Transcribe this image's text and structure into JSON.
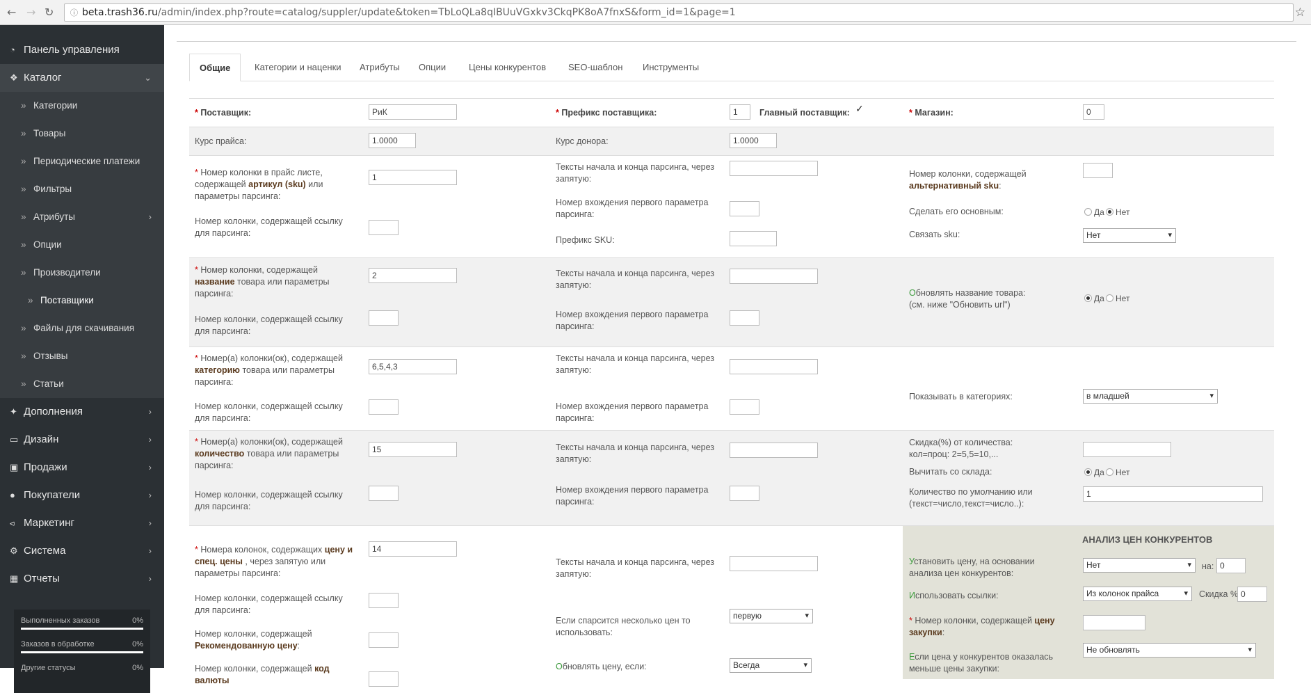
{
  "browser": {
    "url_host": "beta.trash36.ru",
    "url_path": "/admin/index.php?route=catalog/suppler/update&token=TbLoQLa8qIBUuVGxkv3CkqPK8oA7fnxS&form_id=1&page=1"
  },
  "sidebar": {
    "items": [
      {
        "label": "Панель управления",
        "icon": "dashboard-icon"
      },
      {
        "label": "Каталог",
        "icon": "tag-icon"
      },
      {
        "label": "Дополнения",
        "icon": "puzzle-icon"
      },
      {
        "label": "Дизайн",
        "icon": "monitor-icon"
      },
      {
        "label": "Продажи",
        "icon": "cart-icon"
      },
      {
        "label": "Покупатели",
        "icon": "user-icon"
      },
      {
        "label": "Маркетинг",
        "icon": "share-icon"
      },
      {
        "label": "Система",
        "icon": "gear-icon"
      },
      {
        "label": "Отчеты",
        "icon": "bar-chart-icon"
      }
    ],
    "catalog_sub": [
      "Категории",
      "Товары",
      "Периодические платежи",
      "Фильтры",
      "Атрибуты",
      "Опции",
      "Производители",
      "Поставщики",
      "Файлы для скачивания",
      "Отзывы",
      "Статьи"
    ],
    "stats": [
      {
        "label": "Выполненных заказов",
        "value": "0%"
      },
      {
        "label": "Заказов в обработке",
        "value": "0%"
      },
      {
        "label": "Другие статусы",
        "value": "0%"
      }
    ]
  },
  "tabs": [
    "Общие",
    "Категории и наценки",
    "Атрибуты",
    "Опции",
    "Цены конкурентов",
    "SEO-шаблон",
    "Инструменты"
  ],
  "form": {
    "r1": {
      "supplier_label": "Поставщик:",
      "supplier_value": "РиК",
      "prefix_label": "Префикс поставщика:",
      "prefix_value": "1",
      "main_label": "Главный поставщик:",
      "shop_label": "Магазин:",
      "shop_value": "0"
    },
    "r2": {
      "price_rate_label": "Курс прайса:",
      "price_rate_value": "1.0000",
      "donor_rate_label": "Курс донора:",
      "donor_rate_value": "1.0000"
    },
    "r3": {
      "sku_label_a": "Номер колонки в прайс листе, содержащей ",
      "sku_label_b": "артикул (sku)",
      "sku_label_c": " или параметры парсинга:",
      "sku_value": "1",
      "link_label": "Номер колонки, содержащей ссылку для парсинга:",
      "texts_label": "Тексты начала и конца парсинга, через запятую:",
      "occ_label": "Номер вхождения первого параметра парсинга:",
      "prefix_sku_label": "Префикс SKU:",
      "alt_sku_label_a": "Номер колонки, содержащей ",
      "alt_sku_label_b": "альтернативный sku",
      "alt_sku_label_c": ":",
      "make_main_label": "Сделать его основным:",
      "yes": "Да",
      "no": "Нет",
      "link_sku_label": "Связать sku:",
      "link_sku_value": "Нет"
    },
    "r4": {
      "name_label_a": "Номер колонки, содержащей ",
      "name_label_b": "название",
      "name_label_c": " товара или параметры парсинга:",
      "name_value": "2",
      "update_name_label_a": "О",
      "update_name_label_b": "бновлять название товара:",
      "update_name_label_c": "(см. ниже \"Обновить url\")"
    },
    "r5": {
      "cat_label_a": "Номер(а) колонки(ок), содержащей ",
      "cat_label_b": "категорию",
      "cat_label_c": " товара или параметры парсинга:",
      "cat_value": "6,5,4,3",
      "show_in_label": "Показывать в категориях:",
      "show_in_value": "в младшей"
    },
    "r6": {
      "qty_label_a": "Номер(а) колонки(ок), содержащей ",
      "qty_label_b": "количество",
      "qty_label_c": " товара или параметры парсинга:",
      "qty_value": "15",
      "discount_label": "Скидка(%) от количества: кол=проц: 2=5,5=10,...",
      "subtract_label": "Вычитать со склада:",
      "default_qty_label": "Количество по умолчанию или (текст=число,текст=число..):",
      "default_qty_value": "1"
    },
    "r7": {
      "price_label_a": "Номера колонок, содержащих ",
      "price_label_b": "цену и спец. цены",
      "price_label_c": " , через запятую или параметры парсинга:",
      "price_value": "14",
      "rec_label_a": "Номер колонки, содержащей ",
      "rec_label_b": "Рекомендованную цену",
      "rec_label_c": ":",
      "cur_label_a": "Номер колонки, содержащей ",
      "cur_label_b": "код валюты",
      "multi_label": "Если спарсится несколько цен то использовать:",
      "multi_value": "первую",
      "upd_price_label_a": "О",
      "upd_price_label_b": "бновлять цену, если:",
      "upd_price_value": "Всегда",
      "ana_title": "АНАЛИЗ ЦЕН КОНКУРЕНТОВ",
      "set_price_label_a": "У",
      "set_price_label_b": "становить цену, на основании анализа цен конкурентов:",
      "set_price_value": "Нет",
      "on_label": "на:",
      "on_value": "0",
      "use_links_label_a": "И",
      "use_links_label_b": "спользовать ссылки:",
      "use_links_value": "Из колонок прайса",
      "disc_pct_label": "Скидка %:",
      "disc_pct_value": "0",
      "buy_label_a": "Номер колонки, содержащей ",
      "buy_label_b": "цену закупки",
      "buy_label_c": ":",
      "lower_label_a": "Е",
      "lower_label_b": "сли цена у конкурентов оказалась меньше цены закупки:",
      "lower_value": "Не обновлять"
    }
  }
}
